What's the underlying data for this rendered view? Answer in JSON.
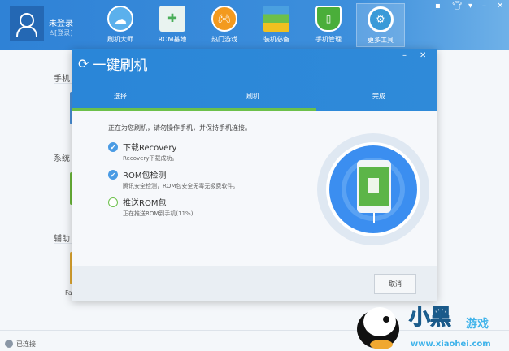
{
  "user": {
    "name": "未登录",
    "login": "[登录]"
  },
  "nav": [
    {
      "label": "刷机大师",
      "icon": "cloud-icon"
    },
    {
      "label": "ROM基地",
      "icon": "rom-bag-icon"
    },
    {
      "label": "热门游戏",
      "icon": "gamepad-icon"
    },
    {
      "label": "装机必备",
      "icon": "apps-icon"
    },
    {
      "label": "手机管理",
      "icon": "phone-shield-icon"
    },
    {
      "label": "更多工具",
      "icon": "wrench-icon",
      "active": true
    }
  ],
  "window_buttons": [
    "feedback",
    "skin",
    "menu",
    "minimize",
    "close"
  ],
  "background": {
    "sections": [
      "手机",
      "系统",
      "辅助"
    ],
    "partial": "Fa"
  },
  "status": {
    "text": "已连接"
  },
  "dialog": {
    "title": "一键刷机",
    "tabs": [
      "选择",
      "刷机",
      "完成"
    ],
    "progress_percent": 67,
    "intro": "正在为您刷机，请勿操作手机，并保持手机连接。",
    "steps": [
      {
        "title": "下载Recovery",
        "sub": "Recovery下载成功。",
        "state": "done"
      },
      {
        "title": "ROM包检测",
        "sub": "腾讯安全检测，ROM包安全无毒无吸费软件。",
        "state": "done"
      },
      {
        "title": "推送ROM包",
        "sub": "正在推送ROM到手机(11%)",
        "state": "running"
      }
    ],
    "cancel": "取消"
  },
  "watermark": {
    "text": "小黑游戏",
    "url": "www.xiaohei.com"
  },
  "colors": {
    "accent": "#2f86d8",
    "green": "#6cc04a"
  }
}
